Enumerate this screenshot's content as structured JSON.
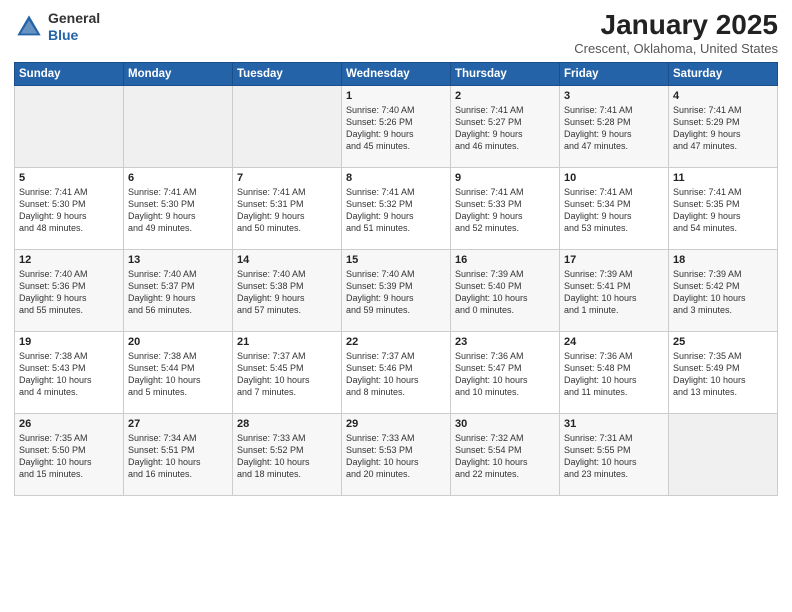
{
  "logo": {
    "line1": "General",
    "line2": "Blue"
  },
  "calendar": {
    "title": "January 2025",
    "subtitle": "Crescent, Oklahoma, United States"
  },
  "headers": [
    "Sunday",
    "Monday",
    "Tuesday",
    "Wednesday",
    "Thursday",
    "Friday",
    "Saturday"
  ],
  "weeks": [
    [
      {
        "day": "",
        "info": ""
      },
      {
        "day": "",
        "info": ""
      },
      {
        "day": "",
        "info": ""
      },
      {
        "day": "1",
        "info": "Sunrise: 7:40 AM\nSunset: 5:26 PM\nDaylight: 9 hours\nand 45 minutes."
      },
      {
        "day": "2",
        "info": "Sunrise: 7:41 AM\nSunset: 5:27 PM\nDaylight: 9 hours\nand 46 minutes."
      },
      {
        "day": "3",
        "info": "Sunrise: 7:41 AM\nSunset: 5:28 PM\nDaylight: 9 hours\nand 47 minutes."
      },
      {
        "day": "4",
        "info": "Sunrise: 7:41 AM\nSunset: 5:29 PM\nDaylight: 9 hours\nand 47 minutes."
      }
    ],
    [
      {
        "day": "5",
        "info": "Sunrise: 7:41 AM\nSunset: 5:30 PM\nDaylight: 9 hours\nand 48 minutes."
      },
      {
        "day": "6",
        "info": "Sunrise: 7:41 AM\nSunset: 5:30 PM\nDaylight: 9 hours\nand 49 minutes."
      },
      {
        "day": "7",
        "info": "Sunrise: 7:41 AM\nSunset: 5:31 PM\nDaylight: 9 hours\nand 50 minutes."
      },
      {
        "day": "8",
        "info": "Sunrise: 7:41 AM\nSunset: 5:32 PM\nDaylight: 9 hours\nand 51 minutes."
      },
      {
        "day": "9",
        "info": "Sunrise: 7:41 AM\nSunset: 5:33 PM\nDaylight: 9 hours\nand 52 minutes."
      },
      {
        "day": "10",
        "info": "Sunrise: 7:41 AM\nSunset: 5:34 PM\nDaylight: 9 hours\nand 53 minutes."
      },
      {
        "day": "11",
        "info": "Sunrise: 7:41 AM\nSunset: 5:35 PM\nDaylight: 9 hours\nand 54 minutes."
      }
    ],
    [
      {
        "day": "12",
        "info": "Sunrise: 7:40 AM\nSunset: 5:36 PM\nDaylight: 9 hours\nand 55 minutes."
      },
      {
        "day": "13",
        "info": "Sunrise: 7:40 AM\nSunset: 5:37 PM\nDaylight: 9 hours\nand 56 minutes."
      },
      {
        "day": "14",
        "info": "Sunrise: 7:40 AM\nSunset: 5:38 PM\nDaylight: 9 hours\nand 57 minutes."
      },
      {
        "day": "15",
        "info": "Sunrise: 7:40 AM\nSunset: 5:39 PM\nDaylight: 9 hours\nand 59 minutes."
      },
      {
        "day": "16",
        "info": "Sunrise: 7:39 AM\nSunset: 5:40 PM\nDaylight: 10 hours\nand 0 minutes."
      },
      {
        "day": "17",
        "info": "Sunrise: 7:39 AM\nSunset: 5:41 PM\nDaylight: 10 hours\nand 1 minute."
      },
      {
        "day": "18",
        "info": "Sunrise: 7:39 AM\nSunset: 5:42 PM\nDaylight: 10 hours\nand 3 minutes."
      }
    ],
    [
      {
        "day": "19",
        "info": "Sunrise: 7:38 AM\nSunset: 5:43 PM\nDaylight: 10 hours\nand 4 minutes."
      },
      {
        "day": "20",
        "info": "Sunrise: 7:38 AM\nSunset: 5:44 PM\nDaylight: 10 hours\nand 5 minutes."
      },
      {
        "day": "21",
        "info": "Sunrise: 7:37 AM\nSunset: 5:45 PM\nDaylight: 10 hours\nand 7 minutes."
      },
      {
        "day": "22",
        "info": "Sunrise: 7:37 AM\nSunset: 5:46 PM\nDaylight: 10 hours\nand 8 minutes."
      },
      {
        "day": "23",
        "info": "Sunrise: 7:36 AM\nSunset: 5:47 PM\nDaylight: 10 hours\nand 10 minutes."
      },
      {
        "day": "24",
        "info": "Sunrise: 7:36 AM\nSunset: 5:48 PM\nDaylight: 10 hours\nand 11 minutes."
      },
      {
        "day": "25",
        "info": "Sunrise: 7:35 AM\nSunset: 5:49 PM\nDaylight: 10 hours\nand 13 minutes."
      }
    ],
    [
      {
        "day": "26",
        "info": "Sunrise: 7:35 AM\nSunset: 5:50 PM\nDaylight: 10 hours\nand 15 minutes."
      },
      {
        "day": "27",
        "info": "Sunrise: 7:34 AM\nSunset: 5:51 PM\nDaylight: 10 hours\nand 16 minutes."
      },
      {
        "day": "28",
        "info": "Sunrise: 7:33 AM\nSunset: 5:52 PM\nDaylight: 10 hours\nand 18 minutes."
      },
      {
        "day": "29",
        "info": "Sunrise: 7:33 AM\nSunset: 5:53 PM\nDaylight: 10 hours\nand 20 minutes."
      },
      {
        "day": "30",
        "info": "Sunrise: 7:32 AM\nSunset: 5:54 PM\nDaylight: 10 hours\nand 22 minutes."
      },
      {
        "day": "31",
        "info": "Sunrise: 7:31 AM\nSunset: 5:55 PM\nDaylight: 10 hours\nand 23 minutes."
      },
      {
        "day": "",
        "info": ""
      }
    ]
  ]
}
